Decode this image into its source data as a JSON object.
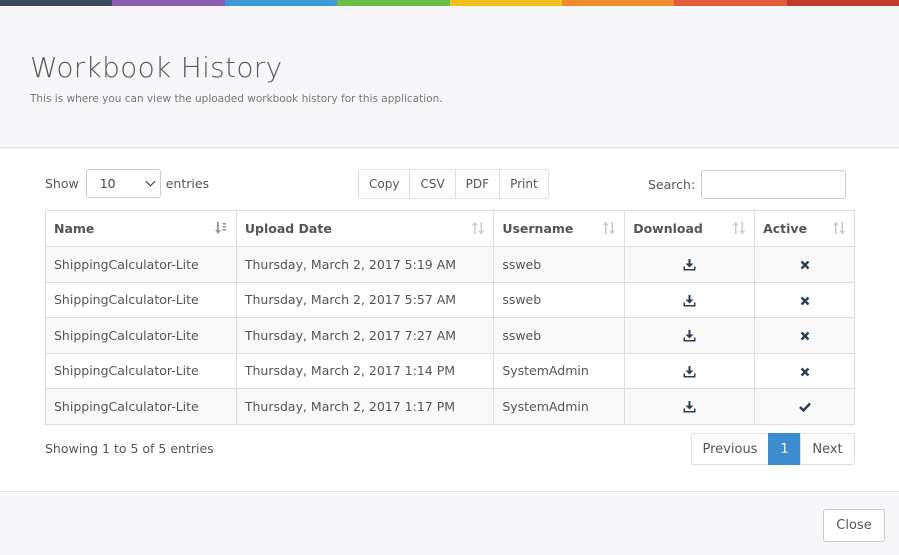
{
  "colors": {
    "topbar": [
      "#3a4a5e",
      "#8e5cb5",
      "#3e9ad6",
      "#6cc04a",
      "#f2c21b",
      "#ef8b2c",
      "#e35d3c",
      "#c0392b"
    ],
    "pager_active": "#3c8dd0"
  },
  "header": {
    "title": "Workbook History",
    "subtitle": "This is where you can view the uploaded workbook history for this application."
  },
  "controls": {
    "show_label": "Show",
    "page_length": "10",
    "entries_label": "entries",
    "buttons": [
      "Copy",
      "CSV",
      "PDF",
      "Print"
    ],
    "search_label": "Search:",
    "search_value": ""
  },
  "table": {
    "columns": [
      "Name",
      "Upload Date",
      "Username",
      "Download",
      "Active"
    ],
    "sorted_column": "Name",
    "rows": [
      {
        "name": "ShippingCalculator-Lite",
        "date": "Thursday, March 2, 2017 5:19 AM",
        "user": "ssweb",
        "download_icon": "download-icon",
        "active": false
      },
      {
        "name": "ShippingCalculator-Lite",
        "date": "Thursday, March 2, 2017 5:57 AM",
        "user": "ssweb",
        "download_icon": "download-icon",
        "active": false
      },
      {
        "name": "ShippingCalculator-Lite",
        "date": "Thursday, March 2, 2017 7:27 AM",
        "user": "ssweb",
        "download_icon": "download-icon",
        "active": false
      },
      {
        "name": "ShippingCalculator-Lite",
        "date": "Thursday, March 2, 2017 1:14 PM",
        "user": "SystemAdmin",
        "download_icon": "download-icon",
        "active": false
      },
      {
        "name": "ShippingCalculator-Lite",
        "date": "Thursday, March 2, 2017 1:17 PM",
        "user": "SystemAdmin",
        "download_icon": "download-icon",
        "active": true
      }
    ]
  },
  "footer_info": "Showing 1 to 5 of 5 entries",
  "pagination": {
    "previous": "Previous",
    "current_page": "1",
    "next": "Next"
  },
  "close_label": "Close"
}
